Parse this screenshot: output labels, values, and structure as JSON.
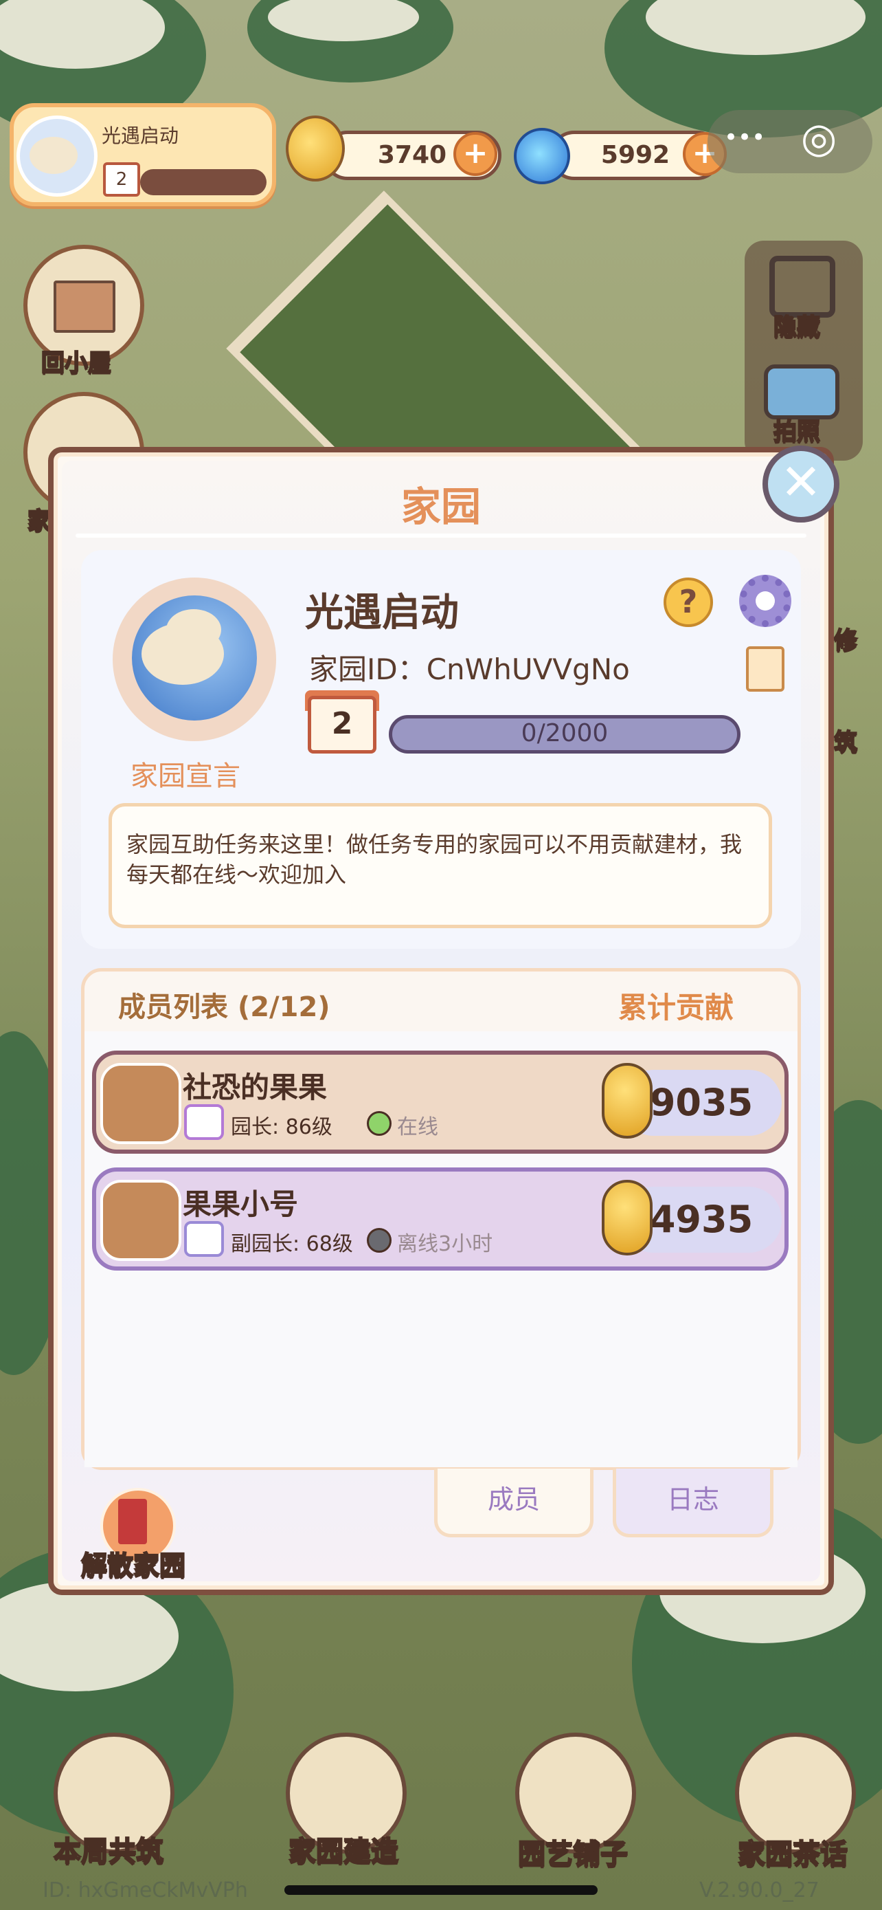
{
  "hud": {
    "player_name": "光遇启动",
    "player_level": "2",
    "coins": "3740",
    "gems": "5992",
    "plus": "+",
    "coin_icon": "golden-snail-coin-icon",
    "gem_icon": "blue-swirl-gem-icon",
    "menu_dots": "•••",
    "target_icon": "◎"
  },
  "side_left": {
    "home_label": "回小屋",
    "gift_label": "家"
  },
  "side_right": {
    "hide_label": "隐藏",
    "photo_label": "拍照",
    "edit_label": "修",
    "build_label": "筑"
  },
  "modal": {
    "title": "家园",
    "close": "✕",
    "garden_name": "光遇启动",
    "garden_id_label": "家园ID：",
    "garden_id": "CnWhUVVgNo",
    "declaration_label": "家园宣言",
    "level": "2",
    "xp": "0/2000",
    "help": "?",
    "description": "家园互助任务来这里！做任务专用的家园可以不用贡献建材，我每天都在线～欢迎加入",
    "members_title": "成员列表 (2/12)",
    "contribution_title": "累计贡献",
    "members": [
      {
        "name": "社恐的果果",
        "role": "园长: 86级",
        "status": "在线",
        "status_color": "#8fd36a",
        "score": "9035"
      },
      {
        "name": "果果小号",
        "role": "副园长: 68级",
        "status": "离线3小时",
        "status_color": "#6a6a70",
        "score": "4935"
      }
    ],
    "tabs": {
      "members": "成员",
      "log": "日志"
    },
    "disband": "解散家园"
  },
  "bottom_nav": [
    {
      "label": "本周共筑",
      "icon": "weekly-build-icon"
    },
    {
      "label": "家园建造",
      "icon": "brick-trowel-icon"
    },
    {
      "label": "园艺铺子",
      "icon": "flower-pot-icon"
    },
    {
      "label": "家园茶话",
      "icon": "chat-bubbles-icon"
    }
  ],
  "footer": {
    "id": "ID: hxGmeCkMvVPh",
    "version": "V.2.90.0_27"
  }
}
